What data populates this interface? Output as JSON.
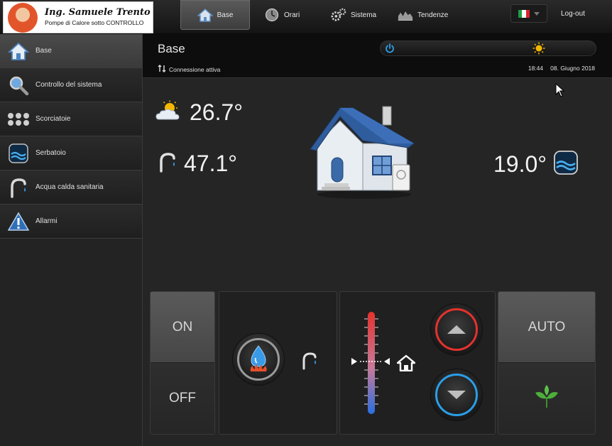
{
  "logo": {
    "name": "Ing. Samuele Trento",
    "tagline": "Pompe di Calore sotto CONTROLLO"
  },
  "nav": {
    "tabs": [
      {
        "label": "Base",
        "icon": "house-icon",
        "active": true
      },
      {
        "label": "Orari",
        "icon": "clock-icon"
      },
      {
        "label": "Sistema",
        "icon": "gears-icon"
      },
      {
        "label": "Tendenze",
        "icon": "trend-chart-icon"
      }
    ],
    "language": "it",
    "logout_label": "Log-out"
  },
  "sidebar": {
    "items": [
      {
        "label": "Base",
        "icon": "house-icon",
        "active": true
      },
      {
        "label": "Controllo del sistema",
        "icon": "magnifier-icon"
      },
      {
        "label": "Scorciatoie",
        "icon": "dots-grid-icon"
      },
      {
        "label": "Serbatoio",
        "icon": "tank-water-icon"
      },
      {
        "label": "Acqua calda sanitaria",
        "icon": "faucet-icon"
      },
      {
        "label": "Allarmi",
        "icon": "warning-icon"
      }
    ]
  },
  "header": {
    "title": "Base",
    "connection": "Connessione attiva",
    "time": "18:44",
    "date": "08. Giugno 2018"
  },
  "readings": {
    "outdoor": "26.7°",
    "dhw": "47.1°",
    "tank": "19.0°"
  },
  "controls": {
    "on_label": "ON",
    "off_label": "OFF",
    "auto_label": "AUTO"
  },
  "colors": {
    "accent_blue": "#2a9ee8",
    "accent_red": "#e5322d",
    "eco_green": "#4caf3a"
  }
}
